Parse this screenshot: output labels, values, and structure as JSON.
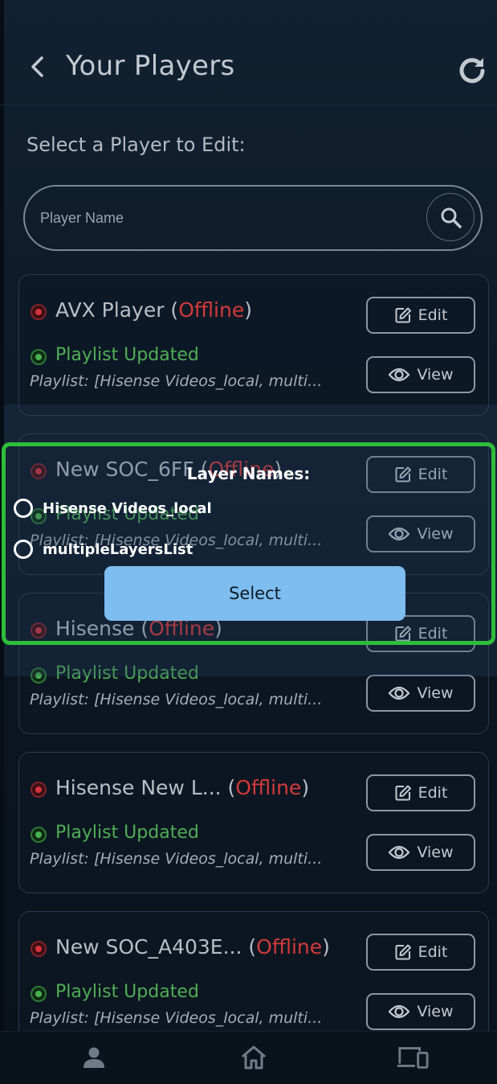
{
  "header": {
    "title": "Your Players",
    "back_icon": "chevron-left-icon",
    "refresh_icon": "refresh-icon"
  },
  "subtitle": "Select a Player to Edit:",
  "search": {
    "placeholder": "Player Name",
    "icon": "search-icon"
  },
  "players": [
    {
      "name": "AVX Player",
      "status": "Offline",
      "playlist_status": "Playlist Updated",
      "playlist": "Playlist: [Hisense Videos_local, multi...",
      "edit_label": "Edit",
      "view_label": "View"
    },
    {
      "name": "New SOC_6FF",
      "status": "Offline",
      "playlist_status": "Playlist Updated",
      "playlist": "Playlist: [Hisense Videos_local, multi...",
      "edit_label": "Edit",
      "view_label": "View"
    },
    {
      "name": "Hisense",
      "status": "Offline",
      "playlist_status": "Playlist Updated",
      "playlist": "Playlist: [Hisense Videos_local, multi...",
      "edit_label": "Edit",
      "view_label": "View"
    },
    {
      "name": "Hisense New L...",
      "status": "Offline",
      "playlist_status": "Playlist Updated",
      "playlist": "Playlist: [Hisense Videos_local, multi...",
      "edit_label": "Edit",
      "view_label": "View"
    },
    {
      "name": "New SOC_A403E...",
      "status": "Offline",
      "playlist_status": "Playlist Updated",
      "playlist": "Playlist: [Hisense Videos_local, multi...",
      "edit_label": "Edit",
      "view_label": "View"
    }
  ],
  "modal": {
    "title": "Layer Names:",
    "options": [
      {
        "label": "Hisense Videos_local"
      },
      {
        "label": "multipleLayersList"
      }
    ],
    "select_label": "Select"
  },
  "bottom_nav": [
    {
      "icon": "user-icon"
    },
    {
      "icon": "home-icon"
    },
    {
      "icon": "devices-icon"
    }
  ],
  "colors": {
    "background": "#0c1622",
    "offline": "#d23a3a",
    "playlist_ok": "#4fae55",
    "modal_border": "#2fbd3a",
    "select_button": "#7dbdf0"
  }
}
